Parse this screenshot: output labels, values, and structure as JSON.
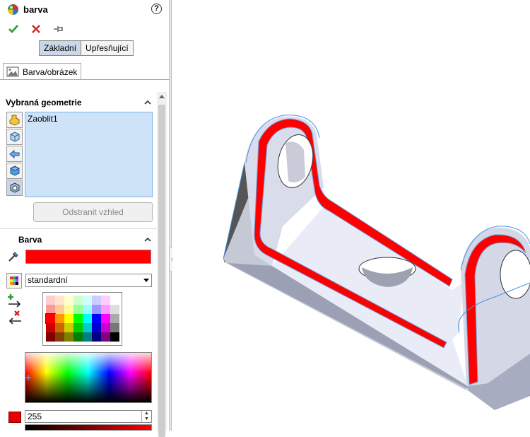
{
  "panel": {
    "title": "barva",
    "help_icon": "?",
    "actions": {
      "ok": "ok-icon",
      "cancel": "cancel-icon",
      "pin": "pin-icon"
    },
    "mode_tabs": [
      {
        "label": "Základní",
        "active": true
      },
      {
        "label": "Upřesňující",
        "active": false
      }
    ],
    "tab": {
      "label": "Barva/obrázek"
    },
    "geometry_section": {
      "heading": "Vybraná geometrie",
      "selected_items": [
        "Zaoblit1"
      ],
      "remove_button": "Odstranit vzhled"
    },
    "color_section": {
      "heading": "Barva",
      "current_color": "#ff0000",
      "palette_dropdown": "standardní",
      "value_field": "255"
    }
  },
  "palette_colors": [
    "#ffcccc",
    "#ffe6cc",
    "#ffffcc",
    "#ccffcc",
    "#ccffff",
    "#ccccff",
    "#ffccff",
    "#ffffff",
    "#ff9999",
    "#ffcc99",
    "#ffff99",
    "#99ff99",
    "#99ffff",
    "#9999ff",
    "#ff99ff",
    "#dddddd",
    "#ff0000",
    "#ff9900",
    "#ffff00",
    "#00ff00",
    "#00ffff",
    "#0000ff",
    "#ff00ff",
    "#aaaaaa",
    "#cc0000",
    "#cc6600",
    "#cccc00",
    "#00cc00",
    "#00cccc",
    "#0000cc",
    "#cc00cc",
    "#777777",
    "#800000",
    "#804000",
    "#808000",
    "#008000",
    "#008080",
    "#000080",
    "#800080",
    "#000000"
  ]
}
